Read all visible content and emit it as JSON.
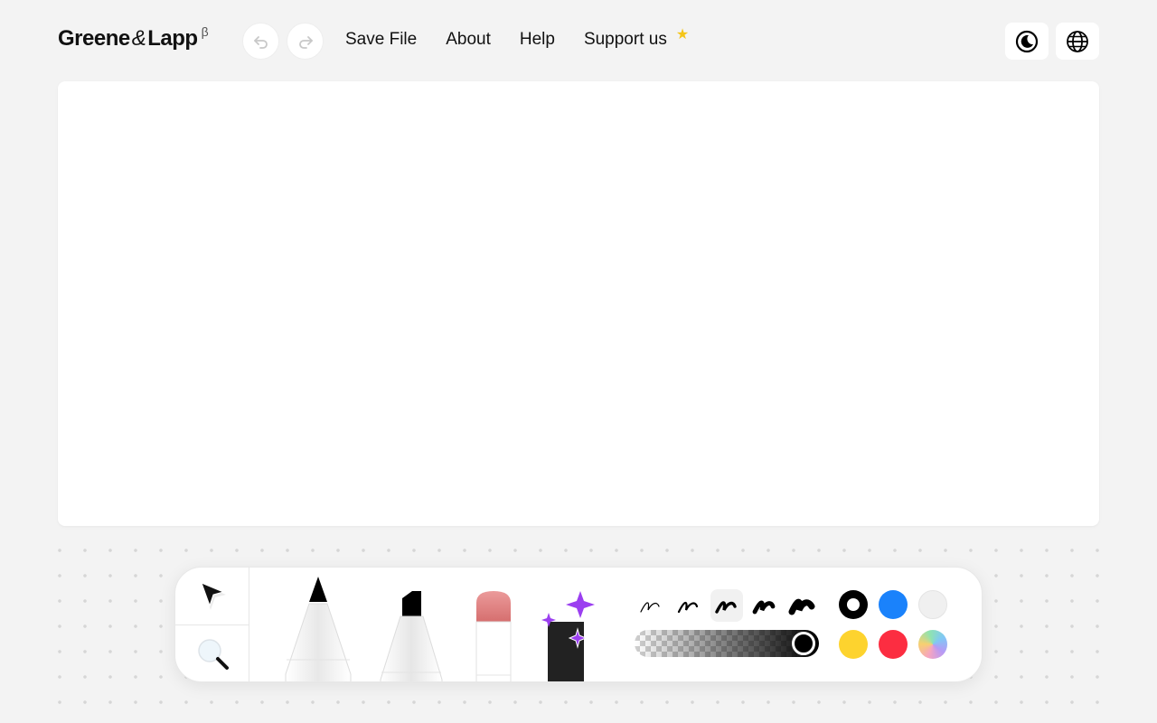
{
  "header": {
    "logo": {
      "part1": "Greene",
      "amp": "&",
      "part2": "Lapp",
      "beta": "β"
    },
    "undo_icon": "undo-icon",
    "redo_icon": "redo-icon",
    "nav": [
      {
        "label": "Save File"
      },
      {
        "label": "About"
      },
      {
        "label": "Help"
      },
      {
        "label": "Support us"
      }
    ],
    "support_star": "★",
    "theme_icon": "moon-icon",
    "language_icon": "globe-icon"
  },
  "toolbar": {
    "tools": [
      "select-arrow-icon",
      "magnifier-icon",
      "pencil-icon",
      "marker-icon",
      "eraser-icon",
      "magic-icon"
    ],
    "stroke_sizes": [
      1,
      2,
      3,
      4,
      5
    ],
    "selected_stroke_size": 3,
    "opacity": 1.0,
    "colors": [
      "#000000",
      "#1a82fb",
      "#f0f0f0",
      "#fdd32e",
      "#fc2d41",
      "rainbow"
    ],
    "selected_color": "#000000"
  }
}
